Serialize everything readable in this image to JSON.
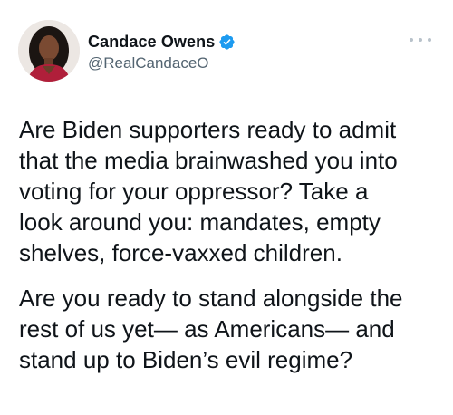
{
  "author": {
    "display_name": "Candace Owens",
    "handle": "@RealCandaceO",
    "verified": true,
    "verified_color": "#1d9bf0",
    "avatar": "profile-photo"
  },
  "menu": {
    "icon": "more-horizontal-icon"
  },
  "tweet": {
    "paragraphs": [
      "Are Biden supporters ready to admit\nthat the media brainwashed you into\nvoting for your oppressor? Take a\nlook around you: mandates, empty\nshelves, force-vaxxed children.",
      "Are you ready to stand alongside the\nrest of us yet— as Americans— and\nstand up to Biden’s evil regime?"
    ]
  },
  "colors": {
    "text": "#0f1419",
    "secondary_text": "#536471",
    "background": "#ffffff"
  }
}
